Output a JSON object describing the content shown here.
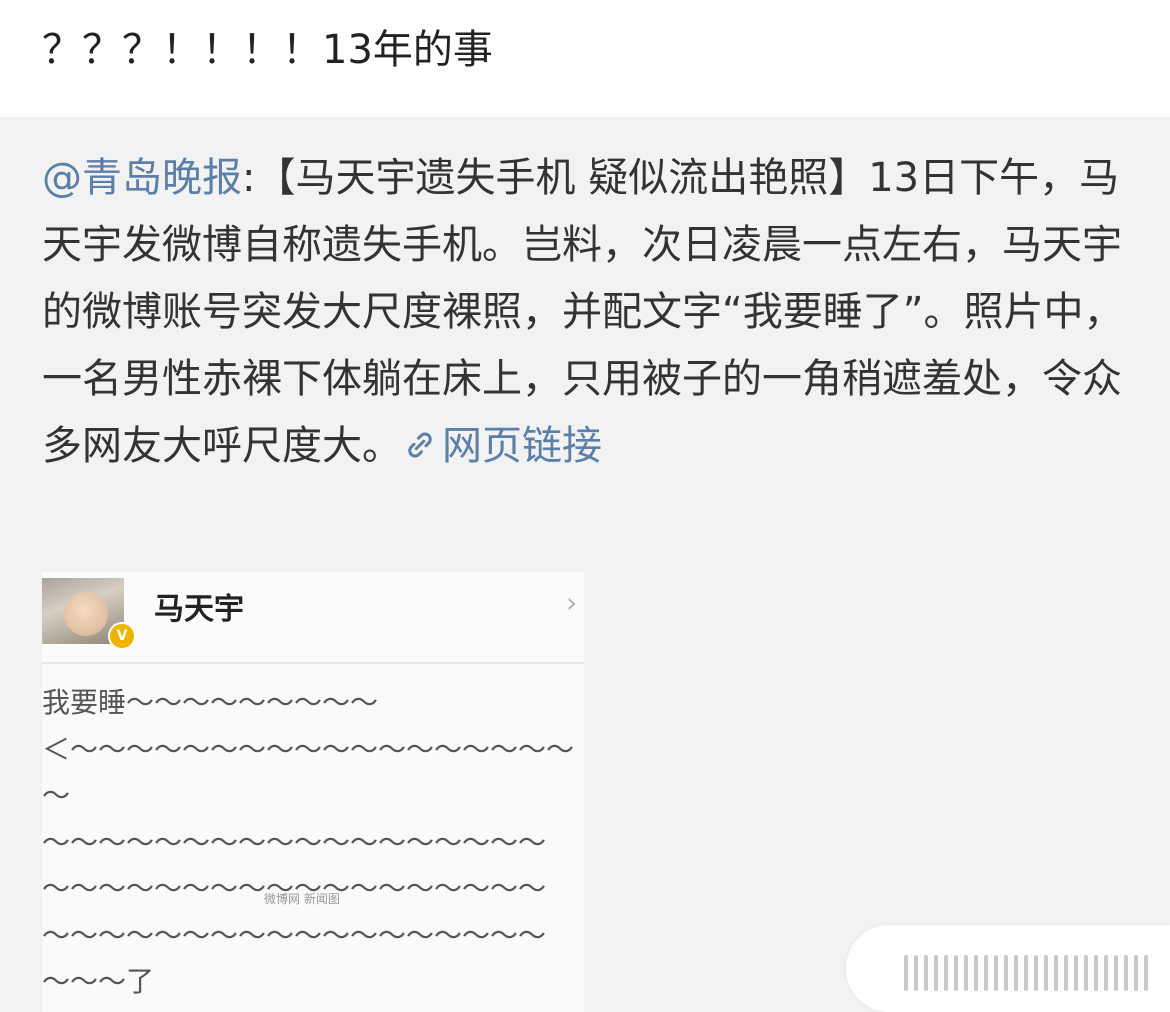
{
  "post": {
    "text": "？？？！！！！13年的事"
  },
  "repost": {
    "mention": "@青岛晚报",
    "body": ":【马天宇遗失手机 疑似流出艳照】13日下午，马天宇发微博自称遗失手机。岂料，次日凌晨一点左右，马天宇的微博账号突发大尺度裸照，并配文字“我要睡了”。照片中，一名男性赤裸下体躺在床上，只用被子的一角稍遮羞处，令众多网友大呼尺度大。",
    "link_label": "网页链接",
    "link_icon": "link-icon"
  },
  "screenshot": {
    "username": "马天宇",
    "avatar_icon": "avatar",
    "badge_icon": "verified-badge-icon",
    "chevron_icon": "chevron-right-icon",
    "content": "我要睡～～～～～～～～～\n＜～～～～～～～～～～～～～～～～～～\n～\n～～～～～～～～～～～～～～～～～～\n～～～～～～～～～～～～～～～～～～\n～～～～～～～～～～～～～～～～～～\n～～～了",
    "watermark": "微博网 新闻图"
  }
}
